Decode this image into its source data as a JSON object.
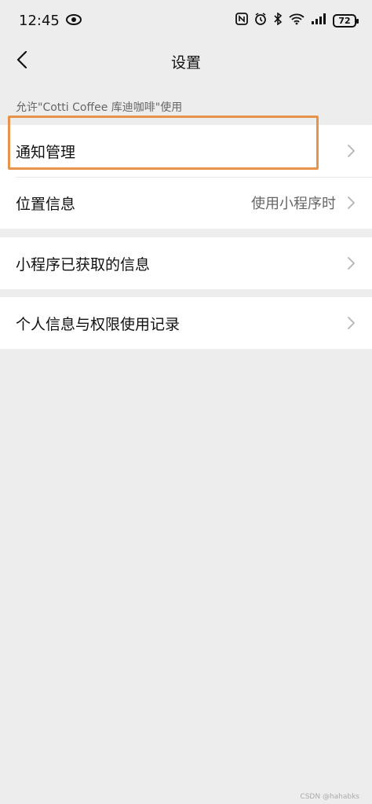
{
  "status_bar": {
    "time": "12:45",
    "eye_icon": "eye-icon",
    "nfc_icon": "nfc-icon",
    "alarm_icon": "alarm-icon",
    "bluetooth_icon": "bluetooth-icon",
    "wifi_icon": "wifi-icon",
    "signal_icon": "signal-icon",
    "battery": "72"
  },
  "nav": {
    "title": "设置",
    "back_icon": "chevron-left-icon"
  },
  "caption": "允许\"Cotti Coffee 库迪咖啡\"使用",
  "groups": [
    {
      "items": [
        {
          "label": "通知管理",
          "value": ""
        },
        {
          "label": "位置信息",
          "value": "使用小程序时"
        }
      ]
    },
    {
      "items": [
        {
          "label": "小程序已获取的信息",
          "value": ""
        }
      ]
    },
    {
      "items": [
        {
          "label": "个人信息与权限使用记录",
          "value": ""
        }
      ]
    }
  ],
  "highlight_color": "#e8914a",
  "watermark": "CSDN @hahabks"
}
